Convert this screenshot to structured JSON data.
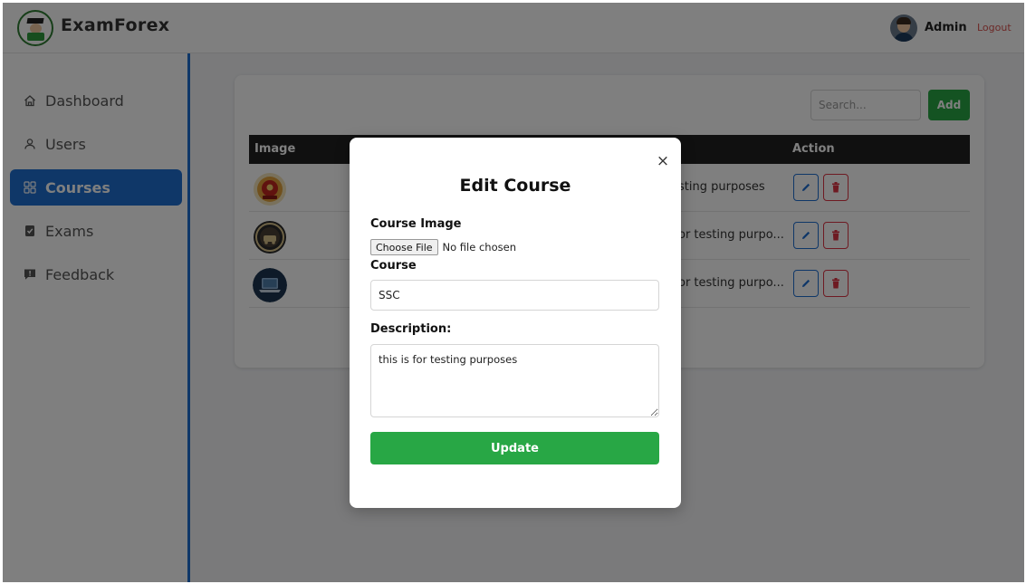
{
  "header": {
    "brand": "ExamForex",
    "user_name": "Admin",
    "logout_label": "Logout"
  },
  "sidebar": {
    "items": [
      {
        "label": "Dashboard",
        "icon": "home-icon",
        "active": false
      },
      {
        "label": "Users",
        "icon": "user-icon",
        "active": false
      },
      {
        "label": "Courses",
        "icon": "grid-icon",
        "active": true
      },
      {
        "label": "Exams",
        "icon": "exam-icon",
        "active": false
      },
      {
        "label": "Feedback",
        "icon": "feedback-icon",
        "active": false
      }
    ]
  },
  "toolbar": {
    "search_placeholder": "Search...",
    "add_label": "Add"
  },
  "table": {
    "columns": {
      "image": "Image",
      "action": "Action"
    },
    "rows": [
      {
        "description": "sting purposes",
        "image_icon": "emblem-icon"
      },
      {
        "description": "or testing purpo...",
        "image_icon": "seal-icon"
      },
      {
        "description": "or testing purpo...",
        "image_icon": "laptop-icon"
      }
    ]
  },
  "modal": {
    "title": "Edit Course",
    "course_image_label": "Course Image",
    "choose_file_label": "Choose File",
    "file_status": "No file chosen",
    "course_label": "Course",
    "course_value": "SSC",
    "description_label": "Description:",
    "description_value": "this is for testing purposes",
    "update_label": "Update",
    "close_symbol": "×"
  },
  "colors": {
    "primary": "#1f6fd1",
    "success": "#28a745",
    "danger": "#dc3545",
    "table_header": "#212121"
  }
}
